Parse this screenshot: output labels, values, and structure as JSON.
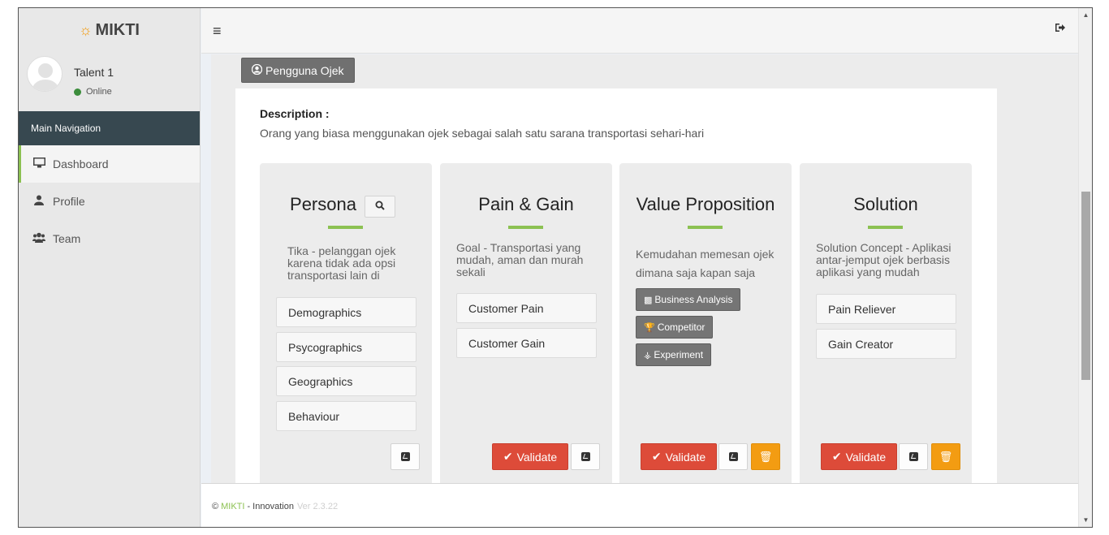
{
  "app": {
    "logo_text": "MIKTI",
    "logo_icon": "lightbulb-icon"
  },
  "user": {
    "name": "Talent 1",
    "status": "Online",
    "status_color": "#3c8d3c"
  },
  "sidebar": {
    "header": "Main Navigation",
    "items": [
      {
        "label": "Dashboard",
        "icon": "desktop-icon",
        "active": true
      },
      {
        "label": "Profile",
        "icon": "user-icon",
        "active": false
      },
      {
        "label": "Team",
        "icon": "users-icon",
        "active": false
      }
    ]
  },
  "header": {
    "menu_icon": "hamburger-icon",
    "signout_icon": "sign-out-icon"
  },
  "segment": {
    "label": "Pengguna Ojek",
    "description_label": "Description :",
    "description": "Orang yang biasa menggunakan ojek sebagai salah satu sarana transportasi sehari-hari"
  },
  "cards": {
    "persona": {
      "title": "Persona",
      "text": "Tika - pelanggan ojek karena tidak ada opsi transportasi lain di",
      "buttons": [
        "Demographics",
        "Psycographics",
        "Geographics",
        "Behaviour"
      ]
    },
    "pain_gain": {
      "title": "Pain & Gain",
      "text": "Goal - Transportasi yang mudah, aman dan murah sekali",
      "buttons": [
        "Customer Pain",
        "Customer Gain"
      ],
      "validate": "Validate"
    },
    "value_prop": {
      "title": "Value Proposition",
      "text": "Kemudahan memesan ojek dimana saja kapan saja",
      "tags": [
        "Business Analysis",
        "Competitor",
        "Experiment"
      ],
      "validate": "Validate"
    },
    "solution": {
      "title": "Solution",
      "text": "Solution Concept - Aplikasi antar-jemput ojek berbasis aplikasi yang mudah",
      "buttons": [
        "Pain Reliever",
        "Gain Creator"
      ],
      "validate": "Validate"
    }
  },
  "footer": {
    "copyright": "©",
    "brand": "MIKTI",
    "text": "- Innovation",
    "version": "Ver 2.3.22"
  },
  "colors": {
    "accent_green": "#8cc152",
    "validate_red": "#dd4b39",
    "delete_orange": "#f39c12",
    "nav_header": "#374850"
  }
}
